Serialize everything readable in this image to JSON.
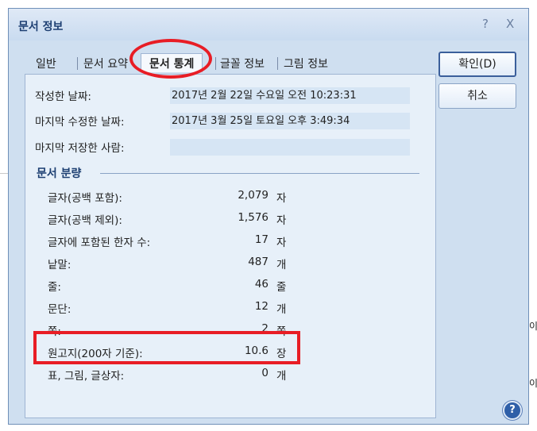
{
  "dialog": {
    "title": "문서 정보",
    "help_glyph": "?",
    "close_glyph": "X"
  },
  "tabs": [
    {
      "label": "일반"
    },
    {
      "label": "문서 요약"
    },
    {
      "label": "문서 통계",
      "active": true
    },
    {
      "label": "글꼴 정보"
    },
    {
      "label": "그림 정보"
    }
  ],
  "info": {
    "created_label": "작성한 날짜:",
    "created_value": "2017년 2월 22일 수요일 오전 10:23:31",
    "modified_label": "마지막 수정한 날짜:",
    "modified_value": "2017년 3월 25일 토요일 오후 3:49:34",
    "saved_by_label": "마지막 저장한 사람:",
    "saved_by_value": ""
  },
  "stats": {
    "section_title": "문서 분량",
    "rows": [
      {
        "label": "글자(공백 포함):",
        "value": "2,079",
        "unit": "자"
      },
      {
        "label": "글자(공백 제외):",
        "value": "1,576",
        "unit": "자"
      },
      {
        "label": "글자에 포함된 한자 수:",
        "value": "17",
        "unit": "자"
      },
      {
        "label": "낱말:",
        "value": "487",
        "unit": "개"
      },
      {
        "label": "줄:",
        "value": "46",
        "unit": "줄"
      },
      {
        "label": "문단:",
        "value": "12",
        "unit": "개"
      },
      {
        "label": "쪽:",
        "value": "2",
        "unit": "쪽"
      },
      {
        "label": "원고지(200자 기준):",
        "value": "10.6",
        "unit": "장"
      },
      {
        "label": "표, 그림, 글상자:",
        "value": "0",
        "unit": "개"
      }
    ]
  },
  "buttons": {
    "ok": "확인(D)",
    "cancel": "취소",
    "help": "?"
  },
  "annotations": {
    "color": "#e81d25"
  },
  "background_fragments": [
    "이",
    "이"
  ]
}
